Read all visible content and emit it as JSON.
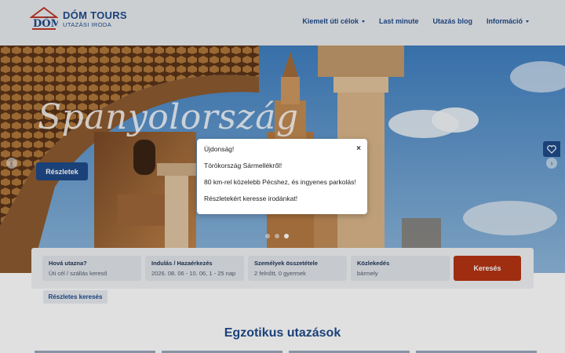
{
  "header": {
    "logo_title": "DÓM TOURS",
    "logo_subtitle": "UTAZÁSI IRODA",
    "nav": [
      {
        "label": "Kiemelt úti célok",
        "has_dropdown": true
      },
      {
        "label": "Last minute",
        "has_dropdown": false
      },
      {
        "label": "Utazás blog",
        "has_dropdown": false
      },
      {
        "label": "Információ",
        "has_dropdown": true
      }
    ]
  },
  "hero": {
    "title": "Spanyolország",
    "button_label": "Részletek",
    "prev_icon": "chevron-left-icon",
    "next_icon": "chevron-right-icon",
    "favorite_icon": "heart-icon",
    "slides_count": 3,
    "active_slide": 3
  },
  "search": {
    "destination": {
      "label": "Hová utazna?",
      "placeholder": "Úti cél / szállás kereső"
    },
    "dates": {
      "label": "Indulás / Hazaérkezés",
      "value": "2026. 08. 06 - 10. 06, 1 - 25 nap"
    },
    "persons": {
      "label": "Személyek összetétele",
      "value": "2 felnőtt, 0 gyermek"
    },
    "transport": {
      "label": "Közlekedés",
      "value": "bármely"
    },
    "button_label": "Keresés",
    "detailed_label": "Részletes keresés"
  },
  "section": {
    "title": "Egzotikus utazások"
  },
  "modal": {
    "lines": [
      "Újdonság!",
      "Törökország Sármellékről!",
      "80 km-rel közelebb Pécshez, és ingyenes parkolás!",
      "Részletekért keresse irodánkat!"
    ],
    "close_label": "×"
  },
  "colors": {
    "brand_blue": "#1f4a8a",
    "search_red": "#b63514"
  }
}
